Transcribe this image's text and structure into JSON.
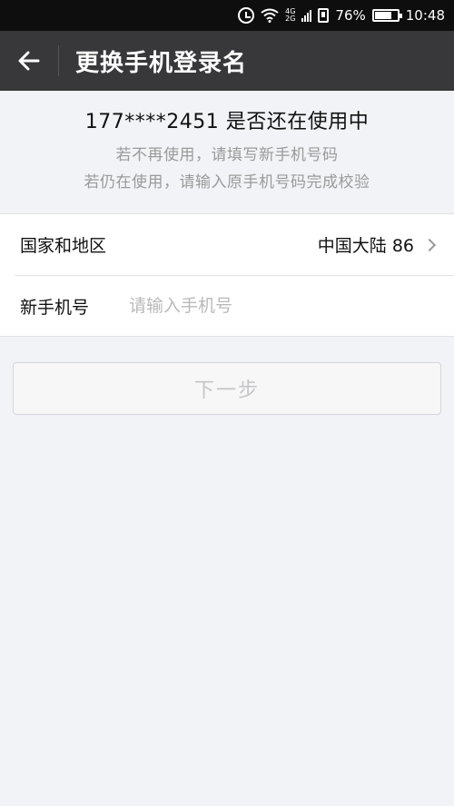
{
  "status_bar": {
    "network": "4G",
    "network_sub": "2G",
    "battery_percent": 76,
    "battery_text": "76%",
    "time": "10:48"
  },
  "header": {
    "title": "更换手机登录名"
  },
  "intro": {
    "main": "177****2451 是否还在使用中",
    "sub_line1": "若不再使用，请填写新手机号码",
    "sub_line2": "若仍在使用，请输入原手机号码完成校验"
  },
  "form": {
    "country_label": "国家和地区",
    "country_value": "中国大陆 86",
    "phone_label": "新手机号",
    "phone_placeholder": "请输入手机号",
    "phone_value": ""
  },
  "actions": {
    "next_label": "下一步"
  },
  "colors": {
    "header_bg": "#38383a",
    "status_bg": "#0e0e0e",
    "page_bg": "#f2f3f7",
    "disabled_text": "#c6c6c8"
  }
}
